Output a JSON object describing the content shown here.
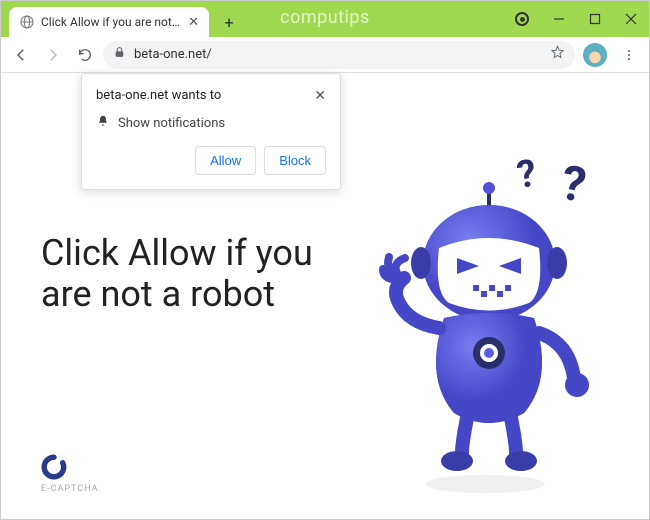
{
  "window": {
    "watermark": "computips"
  },
  "tab": {
    "title": "Click Allow if you are not a robot"
  },
  "address": {
    "url": "beta-one.net/"
  },
  "permission": {
    "title": "beta-one.net wants to",
    "request": "Show notifications",
    "allow": "Allow",
    "block": "Block"
  },
  "page": {
    "headline": "Click Allow if you are not a robot",
    "captcha_label": "E-CAPTCHA"
  },
  "colors": {
    "accent": "#a0d850",
    "robot": "#4f52d8",
    "link": "#1a73e8"
  }
}
